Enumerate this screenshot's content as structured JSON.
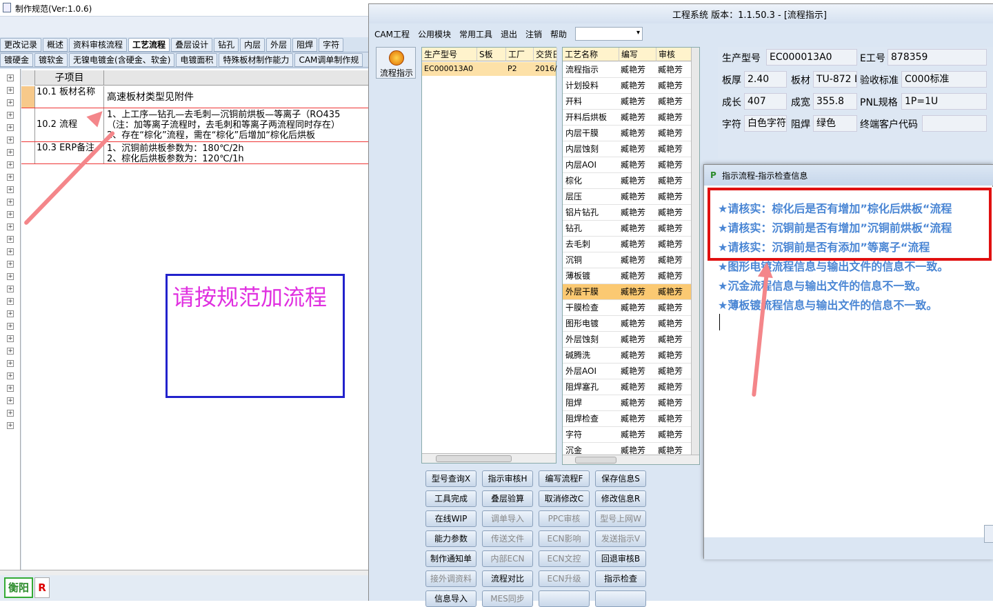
{
  "left_window": {
    "title": "制作规范(Ver:1.0.6)",
    "tabs_row1": [
      "更改记录",
      "概述",
      "资料审核流程",
      "工艺流程",
      "叠层设计",
      "钻孔",
      "内层",
      "外层",
      "阻焊",
      "字符"
    ],
    "active_tab": "工艺流程",
    "tabs_row2": [
      "镀硬金",
      "镀软金",
      "无镍电镀金(含硬金、软金)",
      "电镀面积",
      "特殊板材制作能力",
      "CAM调单制作规"
    ],
    "grid_header": "子项目",
    "rows": [
      {
        "key": "10.1 板材名称",
        "value_lines": [
          "高速板材类型见附件"
        ]
      },
      {
        "key": "10.2 流程",
        "value_lines": [
          "1、上工序—钻孔—去毛刺—沉铜前烘板—等离子（RO435",
          "（注：加等离子流程时，去毛刺和等离子两流程同时存在）",
          "2、存在“棕化”流程，需在“棕化”后增加“棕化后烘板"
        ]
      },
      {
        "key": "10.3 ERP备注",
        "value_lines": [
          "1、沉铜前烘板参数为：180℃/2h",
          "2、棕化后烘板参数为：120℃/1h"
        ]
      }
    ],
    "annotation": "请按规范加流程",
    "status_user": "衡阳",
    "status_r": "R"
  },
  "right_window": {
    "title": "工程系统  版本：1.1.50.3 - [流程指示]",
    "menu": [
      "CAM工程",
      "公用模块",
      "常用工具",
      "退出",
      "注销",
      "帮助"
    ],
    "sidebar_button": "流程指示",
    "product_grid": {
      "headers": [
        "生产型号",
        "S板",
        "工厂",
        "交货日"
      ],
      "row": [
        "EC000013A0",
        "",
        "P2",
        "2016/"
      ]
    },
    "process_grid": {
      "headers": [
        "工艺名称",
        "编写",
        "审核"
      ],
      "rows": [
        "流程指示",
        "计划投料",
        "开料",
        "开料后烘板",
        "内层干膜",
        "内层蚀刻",
        "内层AOI",
        "棕化",
        "层压",
        "铝片钻孔",
        "钻孔",
        "去毛刺",
        "沉铜",
        "薄板镀",
        "外层干膜",
        "干膜检查",
        "图形电镀",
        "外层蚀刻",
        "碱腾洗",
        "外层AOI",
        "阻焊塞孔",
        "阻焊",
        "阻焊检查",
        "字符",
        "沉金"
      ],
      "writer": "臧艳芳",
      "reviewer": "臧艳芳",
      "selected": "外层干膜"
    },
    "buttons": [
      [
        "型号查询X",
        "指示审核H",
        "编写流程F",
        "保存信息S"
      ],
      [
        "工具完成",
        "叠层验算",
        "取消修改C",
        "修改信息R"
      ],
      [
        "在线WIP",
        "调单导入",
        "PPC审核",
        "型号上网W"
      ],
      [
        "能力参数",
        "传送文件",
        "ECN影响",
        "发送指示V"
      ],
      [
        "制作通知单",
        "内部ECN",
        "ECN文控",
        "回退审核B"
      ],
      [
        "接外调资料",
        "流程对比",
        "ECN升级",
        "指示检查"
      ],
      [
        "信息导入",
        "MES同步",
        "",
        ""
      ]
    ],
    "disabled_buttons": [
      "调单导入",
      "PPC审核",
      "型号上网W",
      "传送文件",
      "ECN影响",
      "发送指示V",
      "内部ECN",
      "ECN文控",
      "接外调资料",
      "ECN升级",
      "MES同步"
    ],
    "info": {
      "生产型号": "EC000013A0",
      "E工号": "878359",
      "板厚": "2.40",
      "板材": "TU-872 L",
      "验收标准": "C000标准",
      "成长": "407",
      "成宽": "355.8",
      "PNL规格": "1P=1U",
      "字符": "白色字符",
      "阻焊": "绿色",
      "终端客户代码": ""
    }
  },
  "popup": {
    "title": "指示流程-指示检查信息",
    "messages": [
      "★请核实：棕化后是否有增加”棕化后烘板“流程",
      "★请核实：沉铜前是否有增加”沉铜前烘板“流程",
      "★请核实：沉铜前是否有添加”等离子“流程",
      "★图形电镀流程信息与输出文件的信息不一致。",
      "★沉金流程信息与输出文件的信息不一致。",
      "★薄板镀流程信息与输出文件的信息不一致。"
    ]
  },
  "colors": {
    "annotation_arrow": "#f4868a",
    "highlight_box": "#e01010",
    "annotation_text": "#e030e0",
    "message_text": "#4a86d4",
    "selected_row": "#fbc972"
  }
}
